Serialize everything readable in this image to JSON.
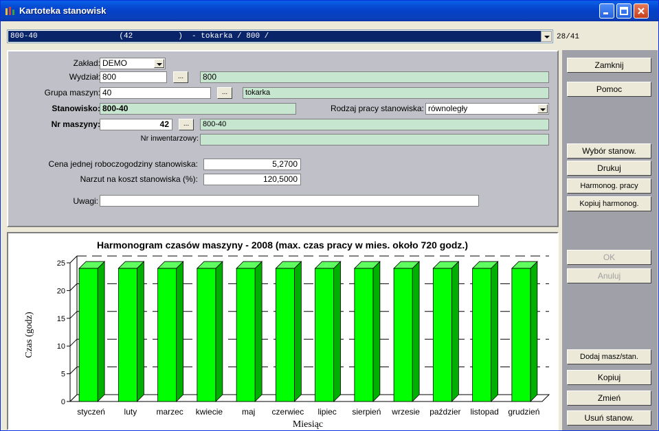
{
  "window": {
    "title": "Kartoteka stanowisk"
  },
  "selector": {
    "value": "800-40                  (42          )  - tokarka / 800 /",
    "counter": "28/41"
  },
  "form": {
    "zaklad": {
      "label": "Zakład:",
      "value": "DEMO"
    },
    "wydzial": {
      "label": "Wydział:",
      "code": "800",
      "name": "800"
    },
    "grupa": {
      "label": "Grupa maszyn:",
      "code": "40",
      "name": "tokarka"
    },
    "stanowisko": {
      "label": "Stanowisko:",
      "value": "800-40"
    },
    "rodzaj": {
      "label": "Rodzaj pracy stanowiska:",
      "value": "równoległy"
    },
    "nr_maszyny": {
      "label": "Nr maszyny:",
      "value": "42",
      "name": "800-40"
    },
    "nr_inw": {
      "label": "Nr inwentarzowy:",
      "value": ""
    },
    "cena": {
      "label": "Cena jednej roboczogodziny stanowiska:",
      "value": "5,2700"
    },
    "narzut": {
      "label": "Narzut na  koszt stanowiska (%):",
      "value": "120,5000"
    },
    "uwagi": {
      "label": "Uwagi:",
      "value": ""
    },
    "dots": "..."
  },
  "buttons": {
    "zamknij": "Zamknij",
    "pomoc": "Pomoc",
    "wybor": "Wybór stanow.",
    "drukuj": "Drukuj",
    "harmonog": "Harmonog. pracy",
    "kopiuj_harm": "Kopiuj harmonog.",
    "ok": "OK",
    "anuluj": "Anuluj",
    "dodaj": "Dodaj masz/stan.",
    "kopiuj": "Kopiuj",
    "zmien": "Zmień",
    "usun": "Usuń stanow."
  },
  "colors": {
    "bar": "#00ff00",
    "bar_side": "#00b000",
    "bar_top": "#60ff60"
  },
  "chart_data": {
    "type": "bar",
    "title": "Harmonogram czasów maszyny - 2008  (max. czas pracy w mies. około 720 godz.)",
    "xlabel": "Miesiąc",
    "ylabel": "Czas (godz)",
    "categories": [
      "styczeń",
      "luty",
      "marzec",
      "kwiecie",
      "maj",
      "czerwiec",
      "lipiec",
      "sierpień",
      "wrzesie",
      "paździer",
      "listopad",
      "grudzień"
    ],
    "values": [
      24,
      24,
      24,
      24,
      24,
      24,
      24,
      24,
      24,
      24,
      24,
      24
    ],
    "yticks": [
      0,
      5,
      10,
      15,
      20,
      25
    ],
    "ylim": [
      0,
      25
    ]
  }
}
